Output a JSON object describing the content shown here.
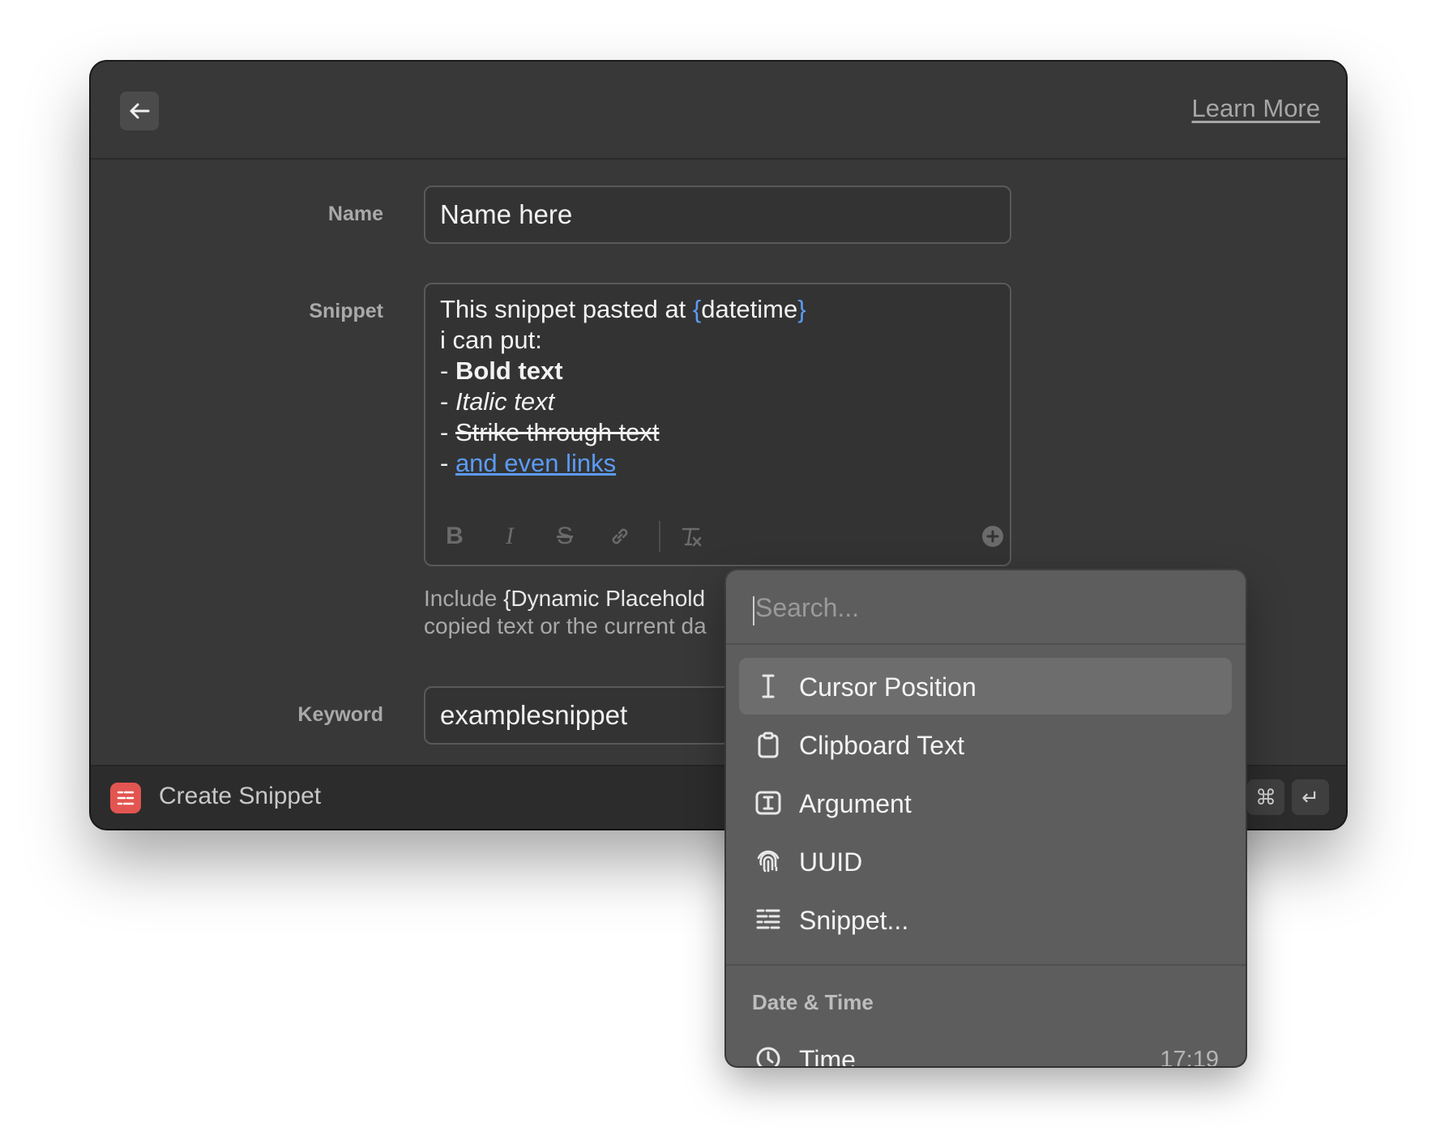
{
  "header": {
    "learn_more": "Learn More"
  },
  "form": {
    "name_label": "Name",
    "name_value": "Name here",
    "snippet_label": "Snippet",
    "snippet": {
      "line1_text": "This snippet pasted at ",
      "line1_open": "{",
      "line1_placeholder": "datetime",
      "line1_close": "}",
      "line2": "i can put:",
      "dash": "- ",
      "bold": "Bold text",
      "italic": "Italic text",
      "strike": "Strike through text",
      "link": "and even links"
    },
    "toolbar": {
      "bold": "B",
      "italic": "I",
      "strike": "S"
    },
    "hint_line1_prefix": "Include ",
    "hint_line1_highlight": "{Dynamic Placehold",
    "hint_line2": "copied text or the current da",
    "keyword_label": "Keyword",
    "keyword_value": "examplesnippet"
  },
  "footer": {
    "title": "Create Snippet",
    "cmd_key": "⌘",
    "enter_key": "↵"
  },
  "popup": {
    "search_placeholder": "Search...",
    "items": [
      {
        "label": "Cursor Position",
        "icon": "cursor-icon",
        "selected": true
      },
      {
        "label": "Clipboard Text",
        "icon": "clipboard-icon"
      },
      {
        "label": "Argument",
        "icon": "argument-icon"
      },
      {
        "label": "UUID",
        "icon": "fingerprint-icon"
      },
      {
        "label": "Snippet...",
        "icon": "snippet-icon"
      }
    ],
    "section_title": "Date & Time",
    "time_item": {
      "label": "Time",
      "value": "17:19",
      "icon": "clock-icon"
    }
  },
  "colors": {
    "placeholder_blue": "#5b9bf5",
    "snippet_red": "#e35550"
  }
}
